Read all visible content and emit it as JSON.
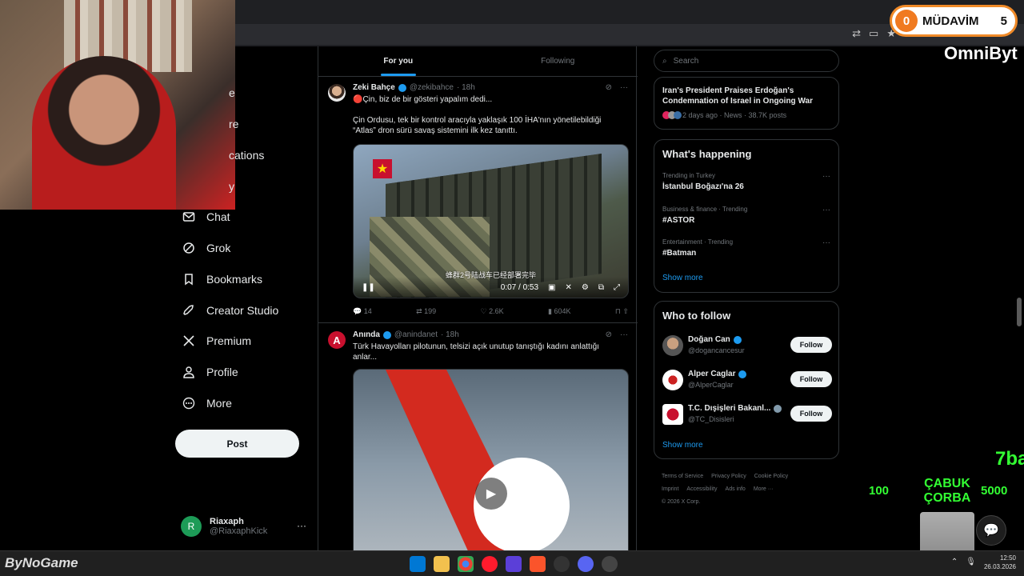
{
  "overlay": {
    "badge_num": "0",
    "badge_label": "MÜDAVİM",
    "badge_count": "5",
    "channel": "OmniByt",
    "green_num": "7ba",
    "cabuk": "ÇABUK ÇORBA",
    "g100": "100",
    "g5000": "5000",
    "watermark": "ByNoGame"
  },
  "nav": {
    "items": [
      "e",
      "re",
      "cations",
      "y",
      "Chat",
      "Grok",
      "Bookmarks",
      "Creator Studio",
      "Premium",
      "Profile",
      "More"
    ],
    "post_label": "Post",
    "account_initial": "R",
    "account_name": "Riaxaph",
    "account_handle": "@RiaxaphKick",
    "account_more": "···"
  },
  "feed": {
    "tabs": [
      "For you",
      "Following"
    ],
    "tweets": [
      {
        "name": "Zeki Bahçe",
        "handle": "@zekibahce",
        "time": "· 18h",
        "text": "🔴Çin, biz de bir gösteri yapalım dedi...\n\nÇin Ordusu, tek bir kontrol aracıyla yaklaşık 100 İHA'nın yönetilebildiği “Atlas” dron sürü savaş sistemini ilk kez tanıttı.",
        "video_time": "0:07 / 0:53",
        "subtitle": "蜂群2号陆战车已经部署完毕",
        "replies": "14",
        "reposts": "199",
        "likes": "2.6K",
        "views": "604K"
      },
      {
        "name": "Anında",
        "handle": "@anindanet",
        "time": "· 18h",
        "text": "Türk Havayolları pilotunun, telsizi açık unutup tanıştığı kadını anlattığı anlar..."
      }
    ]
  },
  "right": {
    "search_placeholder": "Search",
    "news_title": "Iran's President Praises Erdoğan's Condemnation of Israel in Ongoing War",
    "news_meta": "2 days ago · News · 38.7K posts",
    "happening_title": "What's happening",
    "trends": [
      {
        "context": "Trending in Turkey",
        "name": "İstanbul Boğazı'na 26"
      },
      {
        "context": "Business & finance · Trending",
        "name": "#ASTOR"
      },
      {
        "context": "Entertainment · Trending",
        "name": "#Batman"
      }
    ],
    "show_more": "Show more",
    "wtf_title": "Who to follow",
    "users": [
      {
        "name": "Doğan Can",
        "handle": "@dogancancesur",
        "btn": "Follow"
      },
      {
        "name": "Alper Caglar",
        "handle": "@AlperCaglar",
        "btn": "Follow"
      },
      {
        "name": "T.C. Dışişleri Bakanl...",
        "handle": "@TC_Disisleri",
        "btn": "Follow"
      }
    ],
    "footer": [
      "Terms of Service",
      "Privacy Policy",
      "Cookie Policy",
      "Imprint",
      "Accessibility",
      "Ads info",
      "More ···",
      "© 2026 X Corp."
    ]
  },
  "tray": {
    "time": "12:50",
    "date": "26.03.2026"
  },
  "colors": {
    "accent": "#1d9bf0",
    "green": "#33ff33",
    "orange": "#f07a20"
  }
}
